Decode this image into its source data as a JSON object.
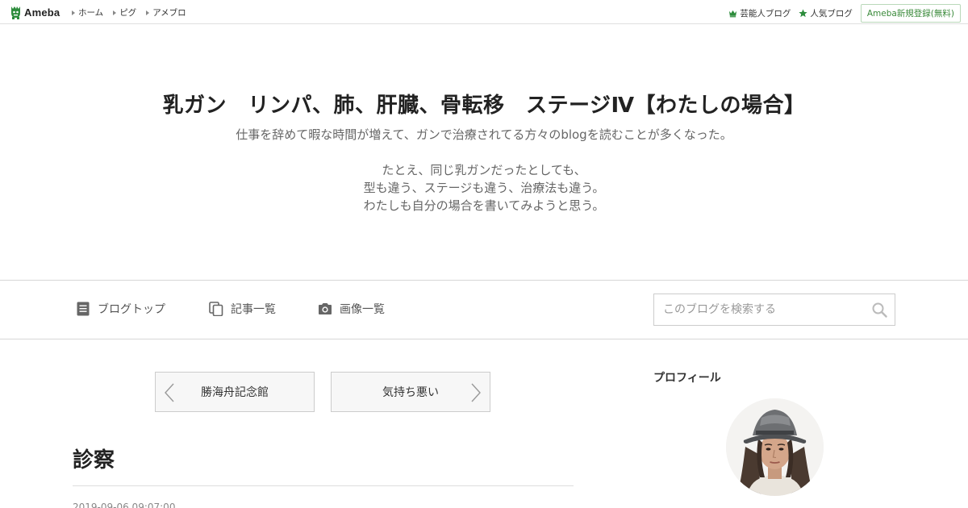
{
  "topbar": {
    "logo_text": "Ameba",
    "nav": [
      "ホーム",
      "ピグ",
      "アメブロ"
    ],
    "celebrity_blog": "芸能人ブログ",
    "popular_blog": "人気ブログ",
    "register": "Ameba新規登録(無料)",
    "brand_color": "#2d8c3c"
  },
  "header": {
    "title": "乳ガン　リンパ、肺、肝臓、骨転移　ステージⅣ【わたしの場合】",
    "description": [
      "仕事を辞めて暇な時間が増えて、ガンで治療されてる方々のblogを読むことが多くなった。",
      "",
      "たとえ、同じ乳ガンだったとしても、",
      "型も違う、ステージも違う、治療法も違う。",
      "わたしも自分の場合を書いてみようと思う。"
    ]
  },
  "nav": {
    "top": "ブログトップ",
    "articles": "記事一覧",
    "images": "画像一覧",
    "search_placeholder": "このブログを検索する"
  },
  "pager": {
    "prev": "勝海舟記念館",
    "next": "気持ち悪い"
  },
  "entry": {
    "title": "診察",
    "date": "2019-09-06 09:07:00"
  },
  "sidebar": {
    "profile_heading": "プロフィール"
  }
}
